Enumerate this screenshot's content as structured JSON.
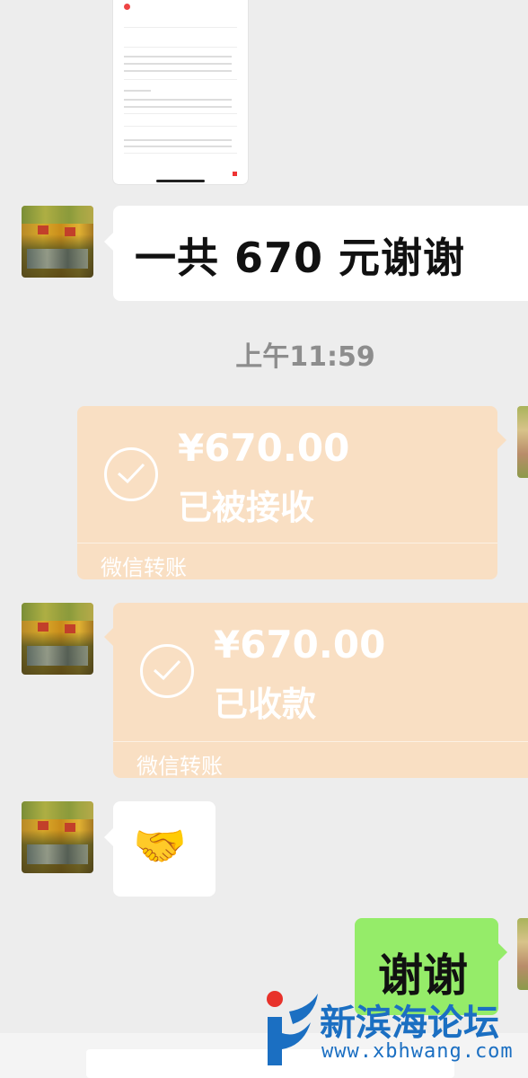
{
  "messages": {
    "received_text": "一共 670 元谢谢",
    "timestamp": "上午11:59",
    "transfer_sent": {
      "amount": "¥670.00",
      "status": "已被接收",
      "footer": "微信转账"
    },
    "transfer_received": {
      "amount": "¥670.00",
      "status": "已收款",
      "footer": "微信转账"
    },
    "emoji": "🤝",
    "sent_text": "谢谢"
  },
  "watermark": {
    "title": "新滨海论坛",
    "url": "www.xbhwang.com"
  },
  "icons": {
    "transfer_check": "check-circle-icon",
    "handshake": "handshake-emoji"
  },
  "colors": {
    "background": "#ededed",
    "transfer_card": "#f9dfc3",
    "sent_bubble": "#95ec69",
    "watermark": "#1b6fc2"
  }
}
